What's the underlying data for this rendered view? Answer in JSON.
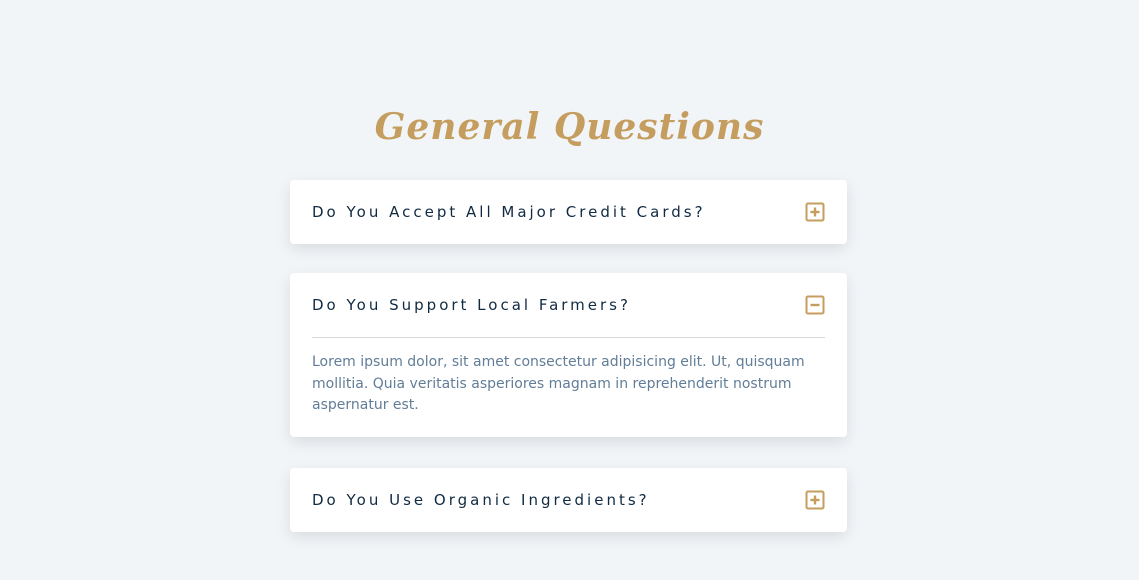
{
  "page": {
    "title": "General Questions"
  },
  "questions": [
    {
      "title": "Do You Accept All Major Credit Cards?",
      "expanded": false,
      "toggle_icon": "plus-square-icon",
      "answer": ""
    },
    {
      "title": "Do You Support Local Farmers?",
      "expanded": true,
      "toggle_icon": "minus-square-icon",
      "answer": "Lorem ipsum dolor, sit amet consectetur adipisicing elit. Ut, quisquam mollitia. Quia veritatis asperiores magnam in reprehenderit nostrum aspernatur est."
    },
    {
      "title": "Do You Use Organic Ingredients?",
      "expanded": false,
      "toggle_icon": "plus-square-icon",
      "answer": ""
    }
  ],
  "colors": {
    "background": "#f1f5f8",
    "accent": "#c59d5f",
    "card": "#ffffff",
    "question_text": "#102a42",
    "answer_text": "#617d98"
  }
}
